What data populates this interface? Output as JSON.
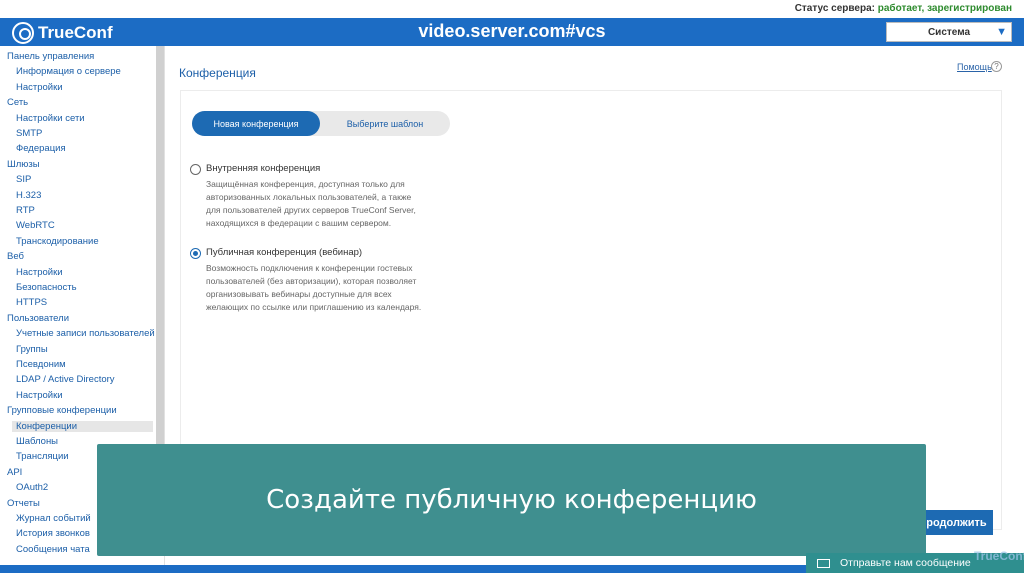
{
  "header": {
    "status_label": "Статус сервера:",
    "status_value": "работает, зарегистрирован",
    "logo_text": "TrueConf",
    "host": "video.server.com#vcs",
    "system_select": "Система"
  },
  "sidebar": {
    "items": [
      {
        "label": "Панель управления",
        "level": 0
      },
      {
        "label": "Информация о сервере",
        "level": 1
      },
      {
        "label": "Настройки",
        "level": 1
      },
      {
        "label": "Сеть",
        "level": 0
      },
      {
        "label": "Настройки сети",
        "level": 1
      },
      {
        "label": "SMTP",
        "level": 1
      },
      {
        "label": "Федерация",
        "level": 1
      },
      {
        "label": "Шлюзы",
        "level": 0
      },
      {
        "label": "SIP",
        "level": 1
      },
      {
        "label": "H.323",
        "level": 1
      },
      {
        "label": "RTP",
        "level": 1
      },
      {
        "label": "WebRTC",
        "level": 1
      },
      {
        "label": "Транскодирование",
        "level": 1
      },
      {
        "label": "Веб",
        "level": 0
      },
      {
        "label": "Настройки",
        "level": 1
      },
      {
        "label": "Безопасность",
        "level": 1
      },
      {
        "label": "HTTPS",
        "level": 1
      },
      {
        "label": "Пользователи",
        "level": 0
      },
      {
        "label": "Учетные записи пользователей",
        "level": 1
      },
      {
        "label": "Группы",
        "level": 1
      },
      {
        "label": "Псевдоним",
        "level": 1
      },
      {
        "label": "LDAP / Active Directory",
        "level": 1
      },
      {
        "label": "Настройки",
        "level": 1
      },
      {
        "label": "Групповые конференции",
        "level": 0
      },
      {
        "label": "Конференции",
        "level": 1,
        "active": true
      },
      {
        "label": "Шаблоны",
        "level": 1
      },
      {
        "label": "Трансляции",
        "level": 1
      },
      {
        "label": "API",
        "level": 0
      },
      {
        "label": "OAuth2",
        "level": 1
      },
      {
        "label": "Отчеты",
        "level": 0
      },
      {
        "label": "Журнал событий",
        "level": 1
      },
      {
        "label": "История звонков",
        "level": 1
      },
      {
        "label": "Сообщения чата",
        "level": 1
      }
    ]
  },
  "main": {
    "title": "Конференция",
    "help": "Помощь",
    "help_icon": "?",
    "tabs": {
      "new": "Новая конференция",
      "template": "Выберите шаблон"
    },
    "options": [
      {
        "title": "Внутренняя конференция",
        "desc_lines": [
          "Защищённая конференция, доступная только для",
          "авторизованных локальных пользователей, а также",
          "для пользователей других серверов TrueConf Server,",
          "находящихся в федерации с вашим сервером."
        ],
        "checked": false
      },
      {
        "title": "Публичная конференция (вебинар)",
        "desc_lines": [
          "Возможность подключения к конференции гостевых",
          "пользователей (без авторизации), которая позволяет",
          "организовывать вебинары доступные для всех",
          "желающих по ссылке или приглашению из календаря."
        ],
        "checked": true
      }
    ],
    "continue": "Продолжить"
  },
  "overlay": {
    "caption": "Создайте публичную конференцию"
  },
  "chat": {
    "label": "Отправьте нам сообщение",
    "watermark": "TrueConf"
  },
  "colors": {
    "brand": "#1c6cc4",
    "button": "#1d6ab3",
    "overlay": "#3f8f8f",
    "status_ok": "#2e8b2e"
  }
}
